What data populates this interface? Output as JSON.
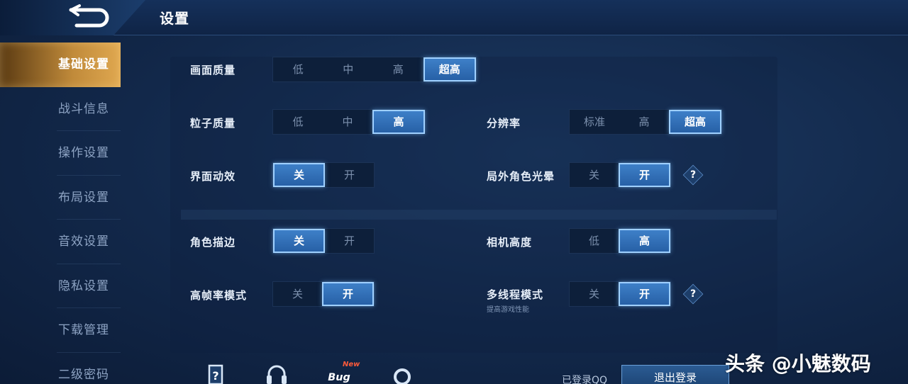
{
  "header": {
    "title": "设置"
  },
  "sidebar": {
    "items": [
      {
        "label": "基础设置"
      },
      {
        "label": "战斗信息"
      },
      {
        "label": "操作设置"
      },
      {
        "label": "布局设置"
      },
      {
        "label": "音效设置"
      },
      {
        "label": "隐私设置"
      },
      {
        "label": "下载管理"
      },
      {
        "label": "二级密码"
      }
    ],
    "active_index": 0
  },
  "settings": {
    "picture_quality": {
      "label": "画面质量",
      "options": [
        "低",
        "中",
        "高",
        "超高"
      ],
      "selected": "超高"
    },
    "particle_quality": {
      "label": "粒子质量",
      "options": [
        "低",
        "中",
        "高"
      ],
      "selected": "高"
    },
    "resolution": {
      "label": "分辨率",
      "options": [
        "标准",
        "高",
        "超高"
      ],
      "selected": "超高"
    },
    "ui_effects": {
      "label": "界面动效",
      "options": [
        "关",
        "开"
      ],
      "selected": "关"
    },
    "outfield_glow": {
      "label": "局外角色光晕",
      "options": [
        "关",
        "开"
      ],
      "selected": "开"
    },
    "character_outline": {
      "label": "角色描边",
      "options": [
        "关",
        "开"
      ],
      "selected": "关"
    },
    "camera_height": {
      "label": "相机高度",
      "options": [
        "低",
        "高"
      ],
      "selected": "高"
    },
    "high_fps_mode": {
      "label": "高帧率模式",
      "options": [
        "关",
        "开"
      ],
      "selected": "开"
    },
    "multithread_mode": {
      "label": "多线程模式",
      "sublabel": "提高游戏性能",
      "options": [
        "关",
        "开"
      ],
      "selected": "开"
    },
    "help_glyph": "?"
  },
  "bottom_bar": {
    "icons": [
      "help-book-icon",
      "headset-icon",
      "bug-report-icon",
      "settings-ring-icon"
    ],
    "bug_label": "Bug",
    "new_tag": "New",
    "login_status": "已登录QQ",
    "logout_label": "退出登录"
  },
  "watermark": "头条 @小魅数码",
  "colors": {
    "selected_fill": "#2f6cb4",
    "selected_border": "#9fd0ff",
    "active_tab": "#c08a3a",
    "new_tag": "#ff5a3a"
  }
}
